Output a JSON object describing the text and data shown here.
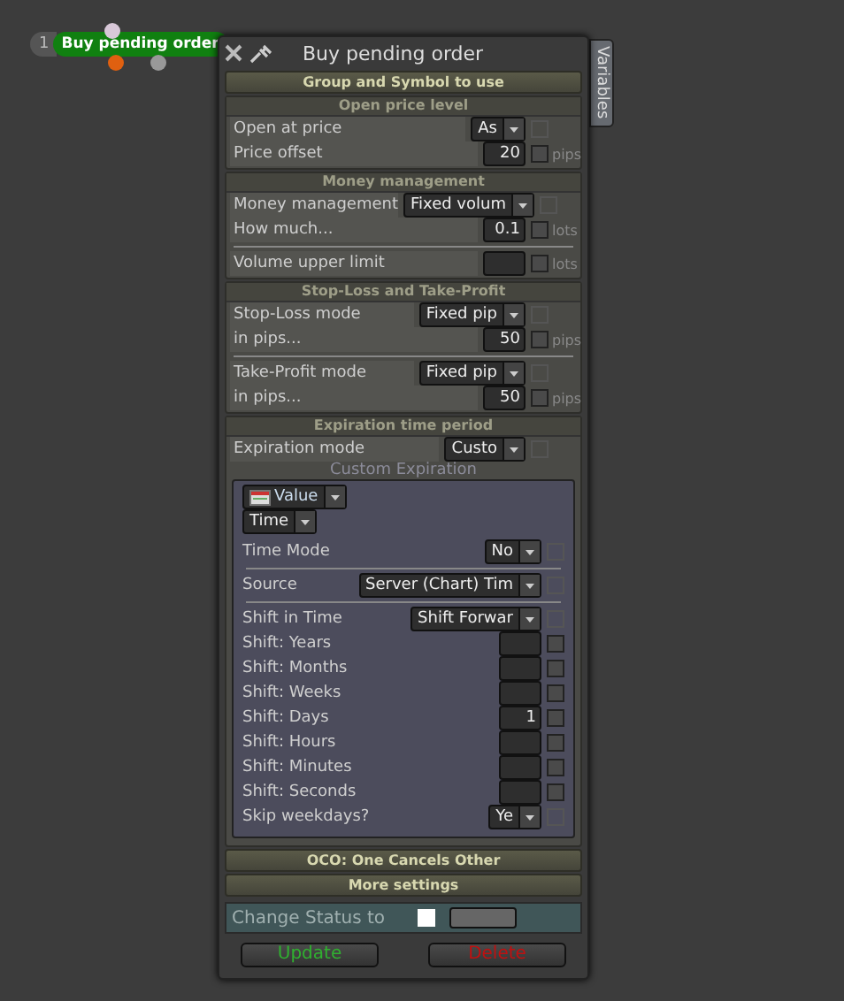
{
  "node": {
    "number": "1",
    "label": "Buy pending order"
  },
  "panel": {
    "title": "Buy pending order",
    "side_tab": "Variables"
  },
  "sections": [
    {
      "kind": "header",
      "title": "Group and Symbol to use"
    },
    {
      "kind": "group",
      "title": "Open price level",
      "blocks": [
        [
          {
            "kind": "select",
            "label": "Open at price",
            "value": "As",
            "checked": false
          },
          {
            "kind": "number",
            "label": "Price offset",
            "value": "20",
            "unit": "pips",
            "checked": false
          }
        ]
      ]
    },
    {
      "kind": "group",
      "title": "Money management",
      "blocks": [
        [
          {
            "kind": "select",
            "label": "Money management",
            "value": "Fixed volum",
            "checked": false
          },
          {
            "kind": "number",
            "label": "How much...",
            "value": "0.1",
            "unit": "lots",
            "checked": false
          }
        ],
        [
          {
            "kind": "number",
            "label": "Volume upper limit",
            "unit": "lots",
            "checked": false
          }
        ]
      ]
    },
    {
      "kind": "group",
      "title": "Stop-Loss and Take-Profit",
      "blocks": [
        [
          {
            "kind": "select",
            "label": "Stop-Loss mode",
            "value": "Fixed pip",
            "checked": false
          },
          {
            "kind": "number",
            "label": "in pips...",
            "value": "50",
            "unit": "pips",
            "checked": false
          }
        ],
        [
          {
            "kind": "select",
            "label": "Take-Profit mode",
            "value": "Fixed pip",
            "checked": false
          },
          {
            "kind": "number",
            "label": "in pips...",
            "value": "50",
            "unit": "pips",
            "checked": false
          }
        ]
      ]
    },
    {
      "kind": "expiration",
      "title": "Expiration time period",
      "mode": {
        "label": "Expiration mode",
        "value": "Custo",
        "checked": false
      },
      "custom": {
        "title": "Custom Expiration",
        "value_select": "Value",
        "type_select": "Time",
        "blocks": [
          [
            {
              "kind": "select",
              "label": "Time Mode",
              "value": "No",
              "checked": false
            }
          ],
          [
            {
              "kind": "select",
              "label": "Source",
              "value": "Server (Chart) Tim",
              "checked": false
            }
          ],
          [
            {
              "kind": "select",
              "label": "Shift in Time",
              "value": "Shift Forwar",
              "checked": false
            },
            {
              "kind": "number",
              "label": "Shift: Years",
              "checked": false
            },
            {
              "kind": "number",
              "label": "Shift: Months",
              "checked": false
            },
            {
              "kind": "number",
              "label": "Shift: Weeks",
              "checked": false
            },
            {
              "kind": "number",
              "label": "Shift: Days",
              "value": "1",
              "checked": false
            },
            {
              "kind": "number",
              "label": "Shift: Hours",
              "checked": false
            },
            {
              "kind": "number",
              "label": "Shift: Minutes",
              "checked": false
            },
            {
              "kind": "number",
              "label": "Shift: Seconds",
              "checked": false
            },
            {
              "kind": "select",
              "label": "Skip weekdays?",
              "value": "Ye",
              "checked": false
            }
          ]
        ]
      }
    },
    {
      "kind": "header",
      "title": "OCO: One Cancels Other"
    },
    {
      "kind": "header",
      "title": "More settings"
    }
  ],
  "status": {
    "label": "Change Status to",
    "checked": false
  },
  "buttons": [
    {
      "label": "Update",
      "kind": "update"
    },
    {
      "label": "Delete",
      "kind": "delete"
    }
  ]
}
